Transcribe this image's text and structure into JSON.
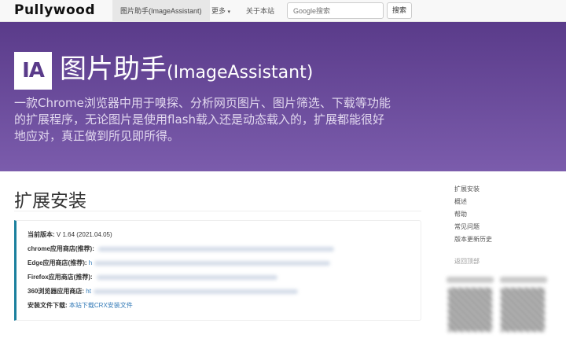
{
  "navbar": {
    "brand": "Pullywood",
    "items": [
      {
        "label": "图片助手(ImageAssistant)",
        "active": true
      },
      {
        "label": "更多",
        "caret": "▾"
      },
      {
        "label": "关于本站"
      }
    ],
    "search_placeholder": "Google搜索",
    "search_button": "搜索"
  },
  "hero": {
    "logo_text": "IA",
    "title_main": "图片助手",
    "title_sub": "(ImageAssistant)",
    "description": "一款Chrome浏览器中用于嗅探、分析网页图片、图片筛选、下载等功能的扩展程序，无论图片是使用flash载入还是动态载入的，扩展都能很好地应对，真正做到所见即所得。"
  },
  "main": {
    "section_title": "扩展安装",
    "rows": [
      {
        "label": "当前版本:",
        "value": "V 1.64 (2021.04.05)"
      },
      {
        "label": "chrome应用商店(推荐):",
        "value": ""
      },
      {
        "label": "Edge应用商店(推荐):",
        "value": "h"
      },
      {
        "label": "Firefox应用商店(推荐):",
        "value": ""
      },
      {
        "label": "360浏览器应用商店:",
        "value": "ht"
      },
      {
        "label": "安装文件下载:",
        "value": "本站下载CRX安装文件"
      }
    ]
  },
  "sidebar": {
    "items": [
      "扩展安装",
      "概述",
      "帮助",
      "常见问题",
      "版本更新历史"
    ],
    "back_to_top": "返回顶部"
  },
  "colors": {
    "hero_top": "#5a3b8a",
    "hero_bottom": "#7b5cac",
    "accent_border": "#1b809e",
    "link": "#337ab7"
  }
}
